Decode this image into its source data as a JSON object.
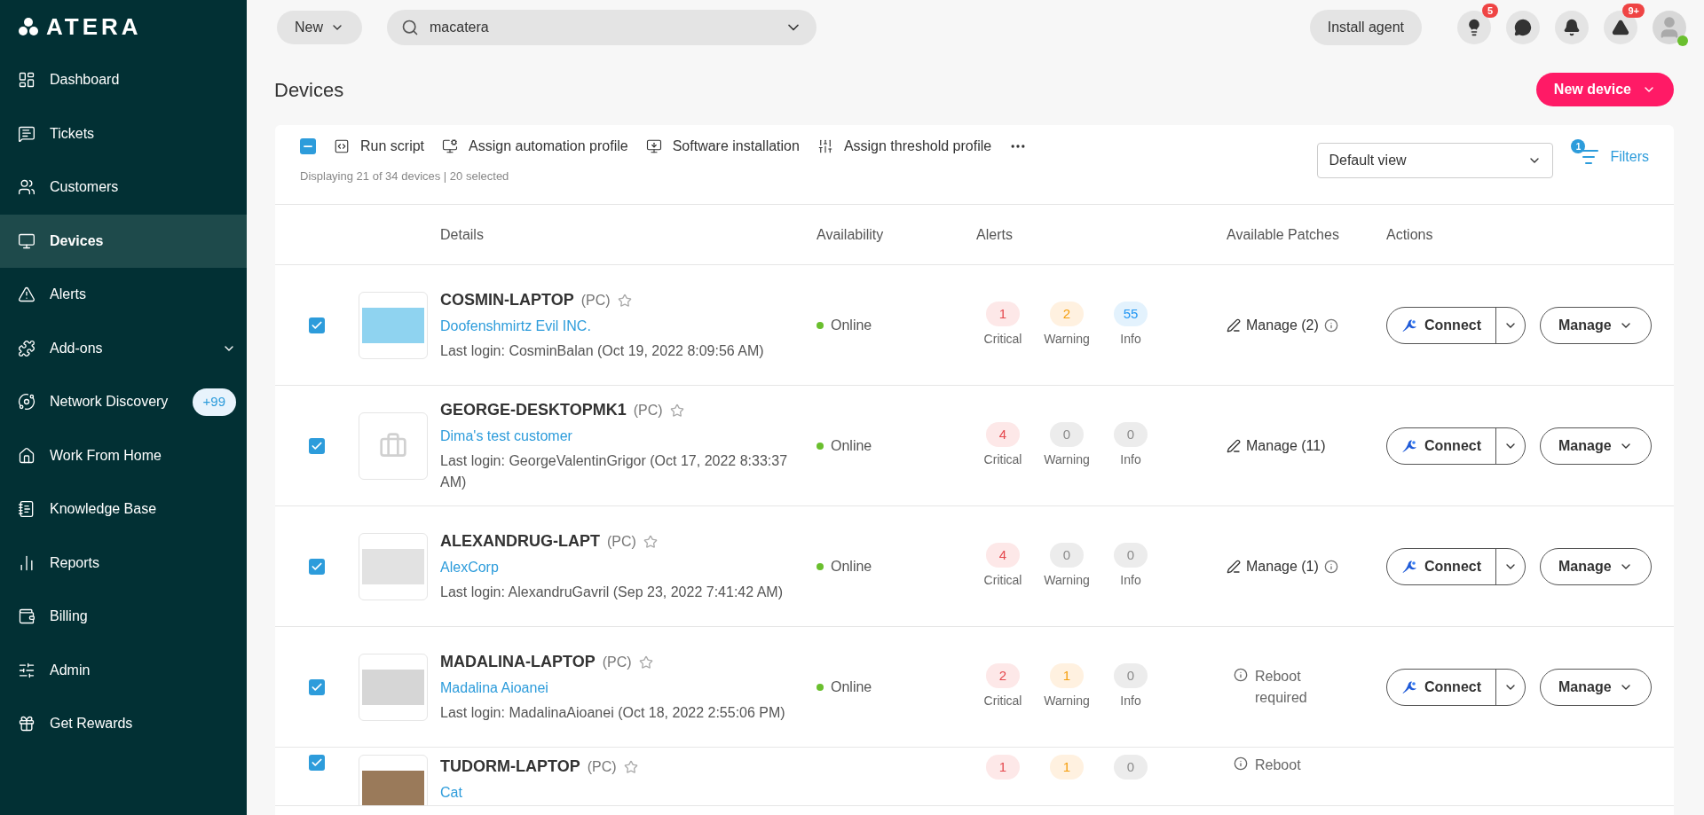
{
  "sidebar": {
    "logo": "ATERA",
    "items": [
      {
        "label": "Dashboard",
        "selected": false
      },
      {
        "label": "Tickets",
        "selected": false
      },
      {
        "label": "Customers",
        "selected": false
      },
      {
        "label": "Devices",
        "selected": true
      },
      {
        "label": "Alerts",
        "selected": false
      },
      {
        "label": "Add-ons",
        "selected": false,
        "expanded": false
      },
      {
        "label": "Network Discovery",
        "selected": false,
        "badge": "+99"
      },
      {
        "label": "Work From Home",
        "selected": false
      },
      {
        "label": "Knowledge Base",
        "selected": false
      },
      {
        "label": "Reports",
        "selected": false
      },
      {
        "label": "Billing",
        "selected": false
      },
      {
        "label": "Admin",
        "selected": false
      },
      {
        "label": "Get Rewards",
        "selected": false
      }
    ]
  },
  "header": {
    "new_button": "New",
    "search": {
      "value": "macatera"
    },
    "install_agent": "Install agent",
    "icons": [
      {
        "kind": "tips",
        "badge": "5"
      },
      {
        "kind": "chat"
      },
      {
        "kind": "notifications"
      },
      {
        "kind": "alerts",
        "badge": "9+"
      }
    ],
    "avatar": {
      "online": true
    }
  },
  "page": {
    "title": "Devices",
    "new_device": "New device"
  },
  "toolbar": {
    "select_all": {
      "checked": true,
      "indeterminate": true
    },
    "actions": [
      "Run script",
      "Assign automation profile",
      "Software installation",
      "Assign threshold profile"
    ],
    "summary": "Displaying 21 of 34 devices | 20 selected",
    "view": "Default view",
    "filters": {
      "label": "Filters",
      "count": "1"
    }
  },
  "table": {
    "columns": [
      "Details",
      "Availability",
      "Alerts",
      "Available Patches",
      "Actions"
    ],
    "rows": [
      {
        "kind": "full",
        "checked": true,
        "name": "COSMIN-LAPTOP",
        "type": "(PC)",
        "favorite": false,
        "customer": "Doofenshmirtz Evil INC.",
        "last_login": "Last login: CosminBalan (Oct 19, 2022 8:09:56 AM)",
        "availability": {
          "label": "Online",
          "color": "#6abf2e"
        },
        "alerts": [
          {
            "value": "1",
            "label": "Critical",
            "muted": false
          },
          {
            "value": "2",
            "label": "Warning",
            "muted": false
          },
          {
            "value": "55",
            "label": "Info",
            "muted": false
          }
        ],
        "patches": {
          "kind": "manage",
          "label": "Manage (2)",
          "info": true
        },
        "connect": "Connect",
        "manage": "Manage"
      },
      {
        "kind": "full",
        "checked": true,
        "name": "GEORGE-DESKTOPMK1",
        "type": "(PC)",
        "favorite": false,
        "customer": "Dima's test customer",
        "last_login": "Last login: GeorgeValentinGrigor (Oct 17, 2022 8:33:37 AM)",
        "availability": {
          "label": "Online",
          "color": "#6abf2e"
        },
        "alerts": [
          {
            "value": "4",
            "label": "Critical",
            "muted": false
          },
          {
            "value": "0",
            "label": "Warning",
            "muted": true
          },
          {
            "value": "0",
            "label": "Info",
            "muted": true
          }
        ],
        "patches": {
          "kind": "manage",
          "label": "Manage (11)",
          "info": false
        },
        "connect": "Connect",
        "manage": "Manage"
      },
      {
        "kind": "full",
        "checked": true,
        "name": "ALEXANDRUG-LAPT",
        "type": "(PC)",
        "favorite": false,
        "customer": "AlexCorp",
        "last_login": "Last login: AlexandruGavril (Sep 23, 2022 7:41:42 AM)",
        "availability": {
          "label": "Online",
          "color": "#6abf2e"
        },
        "alerts": [
          {
            "value": "4",
            "label": "Critical",
            "muted": false
          },
          {
            "value": "0",
            "label": "Warning",
            "muted": true
          },
          {
            "value": "0",
            "label": "Info",
            "muted": true
          }
        ],
        "patches": {
          "kind": "manage",
          "label": "Manage (1)",
          "info": true
        },
        "connect": "Connect",
        "manage": "Manage"
      },
      {
        "kind": "full",
        "checked": true,
        "name": "MADALINA-LAPTOP",
        "type": "(PC)",
        "favorite": false,
        "customer": "Madalina Aioanei",
        "last_login": "Last login: MadalinaAioanei (Oct 18, 2022 2:55:06 PM)",
        "availability": {
          "label": "Online",
          "color": "#6abf2e"
        },
        "alerts": [
          {
            "value": "2",
            "label": "Critical",
            "muted": false
          },
          {
            "value": "1",
            "label": "Warning",
            "muted": false
          },
          {
            "value": "0",
            "label": "Info",
            "muted": true
          }
        ],
        "patches": {
          "kind": "reboot",
          "label": "Reboot required"
        },
        "connect": "Connect",
        "manage": "Manage"
      },
      {
        "kind": "partial",
        "checked": true,
        "name": "TUDORM-LAPTOP",
        "type": "(PC)",
        "favorite": false,
        "customer": "Cat",
        "alerts": [
          {
            "value": "1",
            "muted": false
          },
          {
            "value": "1",
            "muted": false
          },
          {
            "value": "0",
            "muted": true
          }
        ],
        "patches": {
          "kind": "reboot",
          "label": "Reboot"
        }
      }
    ]
  }
}
